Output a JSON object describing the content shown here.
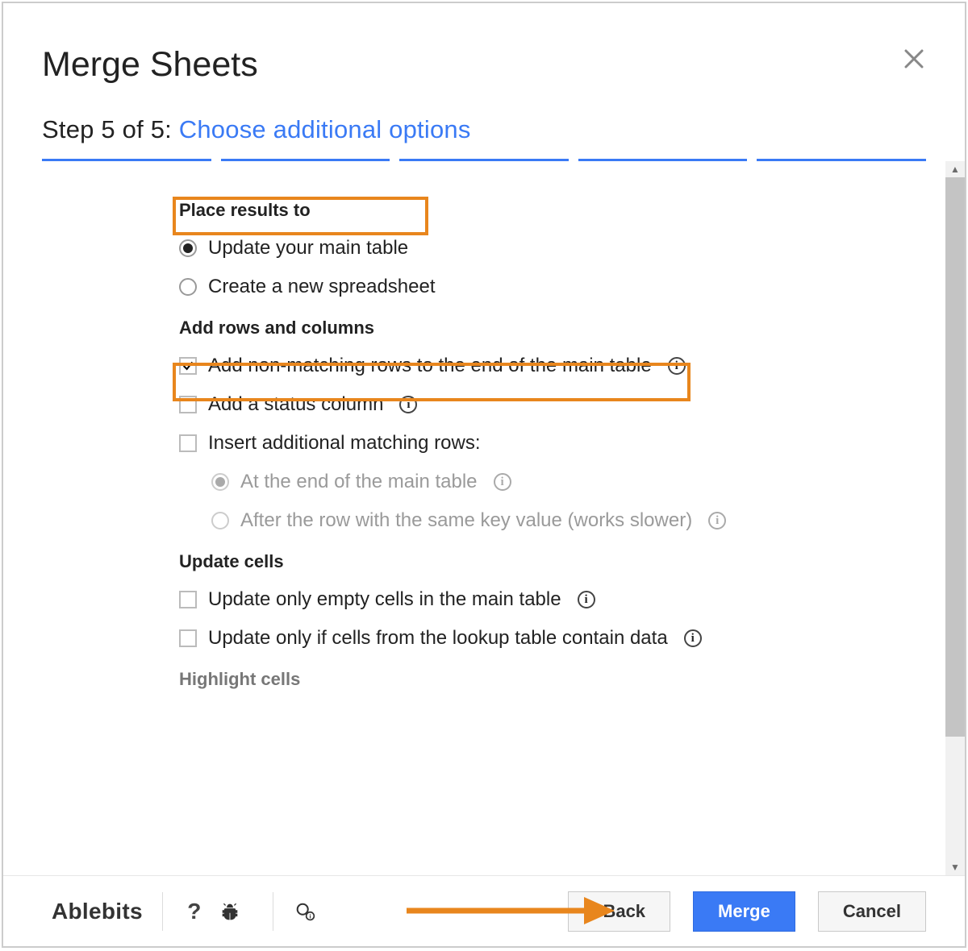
{
  "header": {
    "title": "Merge Sheets"
  },
  "step": {
    "prefix": "Step 5 of 5: ",
    "subtitle": "Choose additional options"
  },
  "sections": {
    "place": {
      "title": "Place results to",
      "opt_update": "Update your main table",
      "opt_new": "Create a new spreadsheet"
    },
    "rows": {
      "title": "Add rows and columns",
      "opt_nonmatching": "Add non-matching rows to the end of the main table",
      "opt_status": "Add a status column",
      "opt_insert": "Insert additional matching rows:",
      "sub_end": "At the end of the main table",
      "sub_after": "After the row with the same key value (works slower)"
    },
    "update": {
      "title": "Update cells",
      "opt_empty": "Update only empty cells in the main table",
      "opt_lookup": "Update only if cells from the lookup table contain data"
    },
    "highlight": {
      "title": "Highlight cells"
    }
  },
  "footer": {
    "brand": "Ablebits",
    "back": "Back",
    "merge": "Merge",
    "cancel": "Cancel"
  }
}
